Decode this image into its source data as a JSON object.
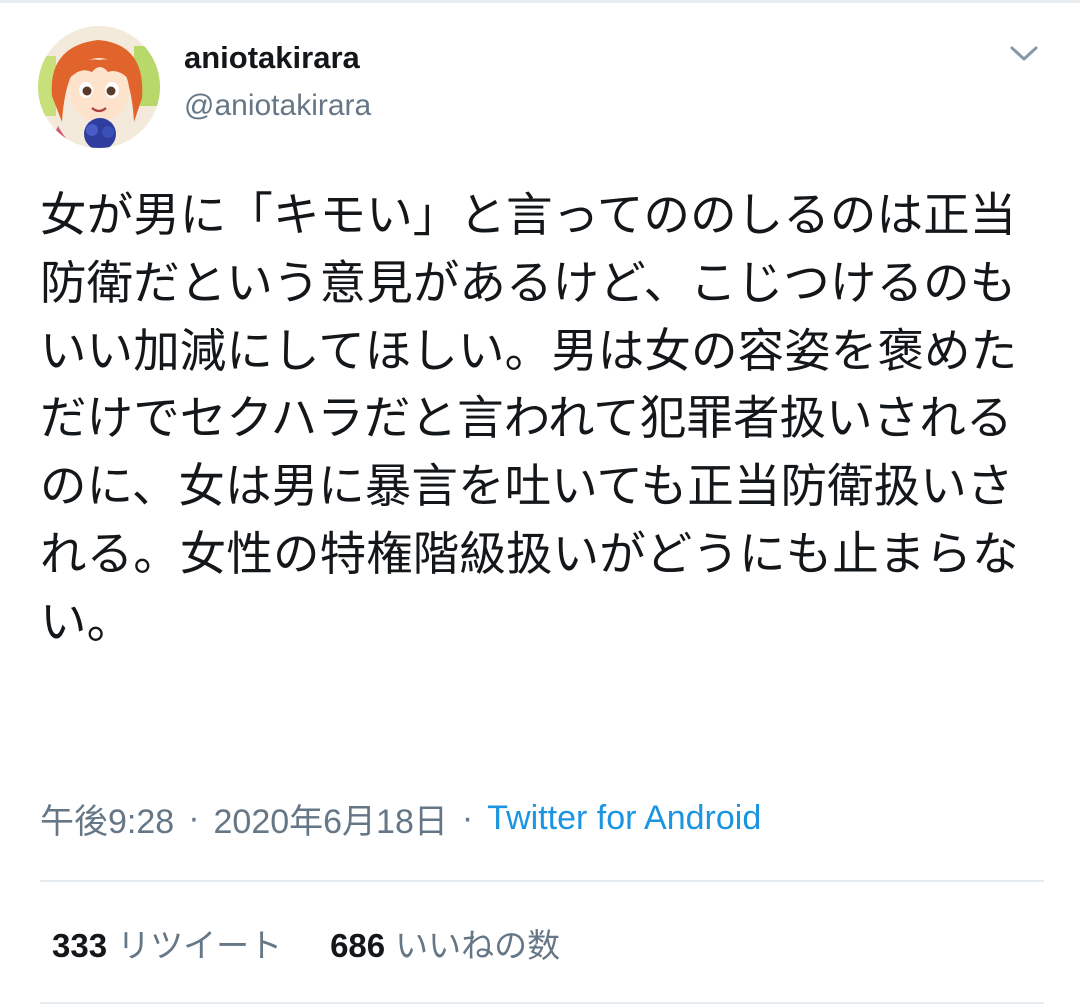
{
  "account": {
    "display_name": "aniotakirara",
    "handle": "@aniotakirara",
    "avatar_icon": "avatar-icon",
    "menu_icon": "chevron-down-icon"
  },
  "tweet": {
    "text": "女が男に「キモい」と言ってののしるのは正当防衛だという意見があるけど、こじつけるのもいい加減にしてほしい。男は女の容姿を褒めただけでセクハラだと言われて犯罪者扱いされるのに、女は男に暴言を吐いても正当防衛扱いされる。女性の特権階級扱いがどうにも止まらない。"
  },
  "meta": {
    "time": "午後9:28",
    "separator": "·",
    "date": "2020年6月18日",
    "source": "Twitter for Android"
  },
  "stats": {
    "retweets": {
      "count": "333",
      "label": "リツイート"
    },
    "likes": {
      "count": "686",
      "label": "いいねの数"
    }
  },
  "colors": {
    "text": "#14171a",
    "secondary": "#657786",
    "link": "#1b95e0",
    "divider": "#e6ecf0"
  }
}
